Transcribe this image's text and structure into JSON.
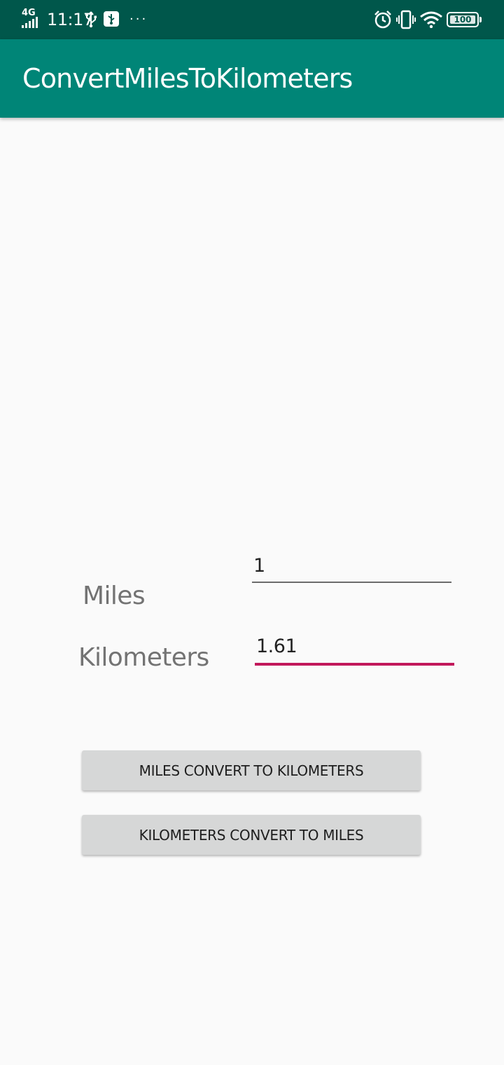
{
  "status_bar": {
    "network_type": "4G",
    "time": "11:17",
    "more": "···",
    "battery_level": 100,
    "battery_label": "100",
    "background_color": "#00574b"
  },
  "app_bar": {
    "title": "ConvertMilesToKilometers",
    "background_color": "#008577"
  },
  "form": {
    "miles_label": "Miles",
    "miles_value": "1",
    "kilometers_label": "Kilometers",
    "kilometers_value": "1.61",
    "focused_accent_color": "#c2185b"
  },
  "buttons": {
    "miles_to_km": "MILES CONVERT TO KILOMETERS",
    "km_to_miles": "KILOMETERS CONVERT TO MILES"
  },
  "icons": [
    "signal-icon",
    "usb-icon",
    "usb-debug-icon",
    "alarm-icon",
    "vibrate-icon",
    "wifi-icon",
    "battery-icon"
  ]
}
